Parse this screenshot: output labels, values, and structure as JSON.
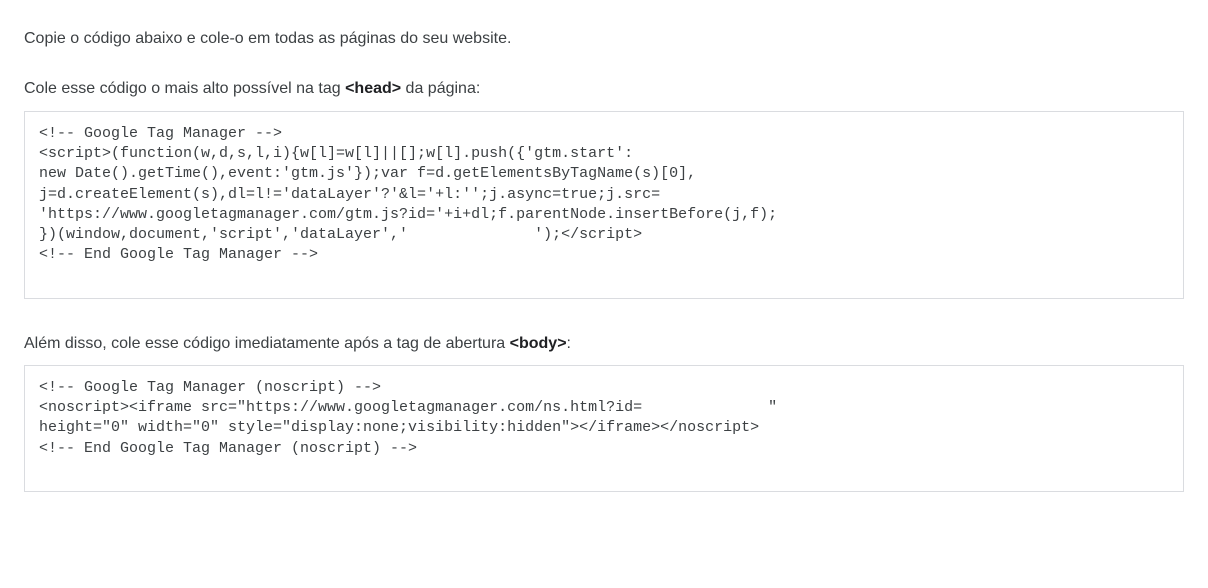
{
  "intro": "Copie o código abaixo e cole-o em todas as páginas do seu website.",
  "section1": {
    "label_before": "Cole esse código o mais alto possível na tag ",
    "tag": "<head>",
    "label_after": " da página:",
    "code": "<!-- Google Tag Manager -->\n<script>(function(w,d,s,l,i){w[l]=w[l]||[];w[l].push({'gtm.start':\nnew Date().getTime(),event:'gtm.js'});var f=d.getElementsByTagName(s)[0],\nj=d.createElement(s),dl=l!='dataLayer'?'&l='+l:'';j.async=true;j.src=\n'https://www.googletagmanager.com/gtm.js?id='+i+dl;f.parentNode.insertBefore(j,f);\n})(window,document,'script','dataLayer','              ');</script>\n<!-- End Google Tag Manager -->"
  },
  "section2": {
    "label_before": "Além disso, cole esse código imediatamente após a tag de abertura ",
    "tag": "<body>",
    "label_after": ":",
    "code": "<!-- Google Tag Manager (noscript) -->\n<noscript><iframe src=\"https://www.googletagmanager.com/ns.html?id=              \"\nheight=\"0\" width=\"0\" style=\"display:none;visibility:hidden\"></iframe></noscript>\n<!-- End Google Tag Manager (noscript) -->"
  }
}
